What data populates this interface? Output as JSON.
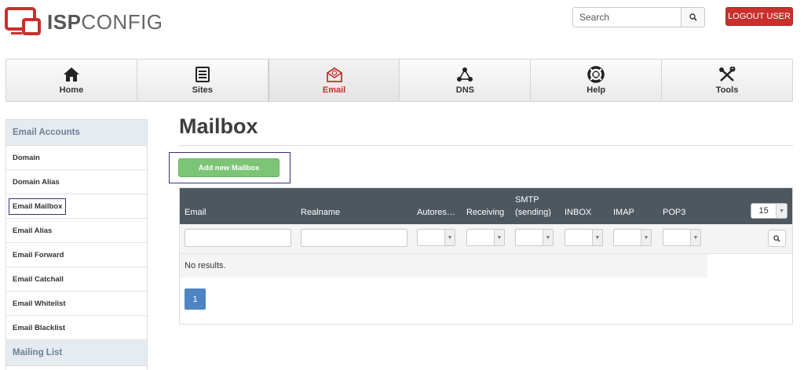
{
  "brand": {
    "logo_text_bold": "ISP",
    "logo_text_light": "CONFIG",
    "colors": {
      "accent": "#c9302c",
      "nav_active": "#c9302c",
      "table_header": "#4d5760",
      "add_button": "#7cc576",
      "page_button": "#4f84c4"
    }
  },
  "header": {
    "search_placeholder": "Search",
    "search_icon": "search-icon",
    "logout_label": "LOGOUT USER"
  },
  "nav": {
    "items": [
      {
        "label": "Home",
        "icon": "home-icon"
      },
      {
        "label": "Sites",
        "icon": "sites-icon"
      },
      {
        "label": "Email",
        "icon": "email-icon",
        "active": true
      },
      {
        "label": "DNS",
        "icon": "dns-icon"
      },
      {
        "label": "Help",
        "icon": "help-icon"
      },
      {
        "label": "Tools",
        "icon": "tools-icon"
      }
    ]
  },
  "sidebar": {
    "section_title": "Email Accounts",
    "items": [
      {
        "label": "Domain"
      },
      {
        "label": "Domain Alias"
      },
      {
        "label": "Email Mailbox",
        "selected": true
      },
      {
        "label": "Email Alias"
      },
      {
        "label": "Email Forward"
      },
      {
        "label": "Email Catchall"
      },
      {
        "label": "Email Whitelist"
      },
      {
        "label": "Email Blacklist"
      }
    ],
    "section2_title": "Mailing List"
  },
  "main": {
    "title": "Mailbox",
    "add_button_label": "Add new Mailbox",
    "table": {
      "columns": [
        "Email",
        "Realname",
        "Autores…",
        "Receiving",
        "SMTP",
        "(sending)",
        "INBOX",
        "IMAP",
        "POP3"
      ],
      "per_page": "15",
      "empty_text": "No results.",
      "pagination": {
        "current_page": "1"
      }
    }
  }
}
